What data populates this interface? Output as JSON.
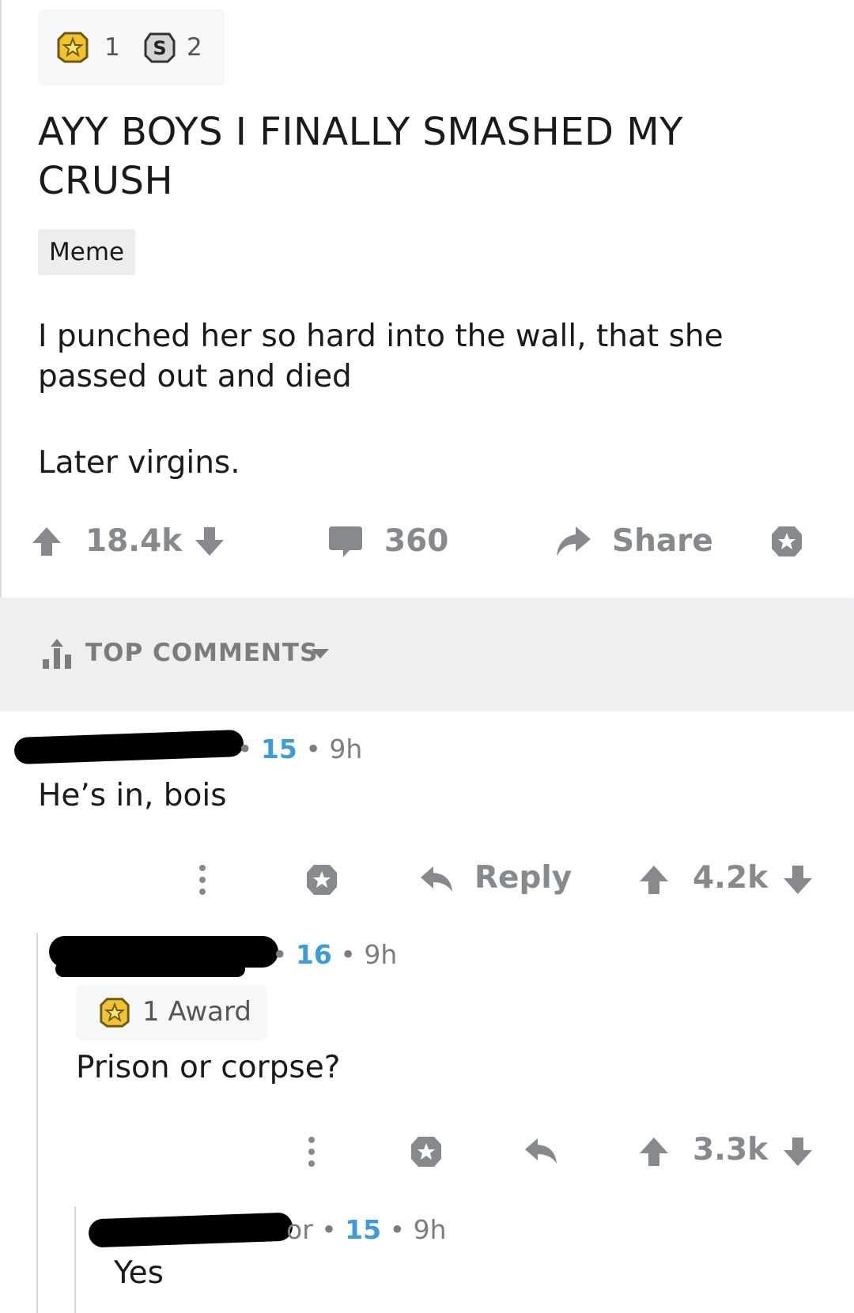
{
  "awards": {
    "gold_count": "1",
    "silver_count": "2"
  },
  "post": {
    "title": "AYY BOYS I FINALLY SMASHED MY CRUSH",
    "flair": "Meme",
    "body_line1": "I punched her so hard into the wall, that she passed out and died",
    "body_line2": "Later virgins.",
    "score": "18.4k",
    "comment_count": "360",
    "share_label": "Share"
  },
  "sort": {
    "label": "TOP COMMENTS"
  },
  "comments": [
    {
      "author_fragment": "•",
      "score": "15",
      "age": "9h",
      "body": "He’s in, bois",
      "reply_label": "Reply",
      "votes": "4.2k"
    },
    {
      "author_fragment": "•",
      "score": "16",
      "age": "9h",
      "award_label": "1 Award",
      "body": "Prison or corpse?",
      "votes": "3.3k"
    },
    {
      "author_fragment": "or •",
      "score": "15",
      "age": "9h",
      "body": "Yes"
    }
  ],
  "colors": {
    "score_blue": "#3f9ad8",
    "icon_gray": "#878a8c",
    "band_gray": "#edeff1"
  }
}
